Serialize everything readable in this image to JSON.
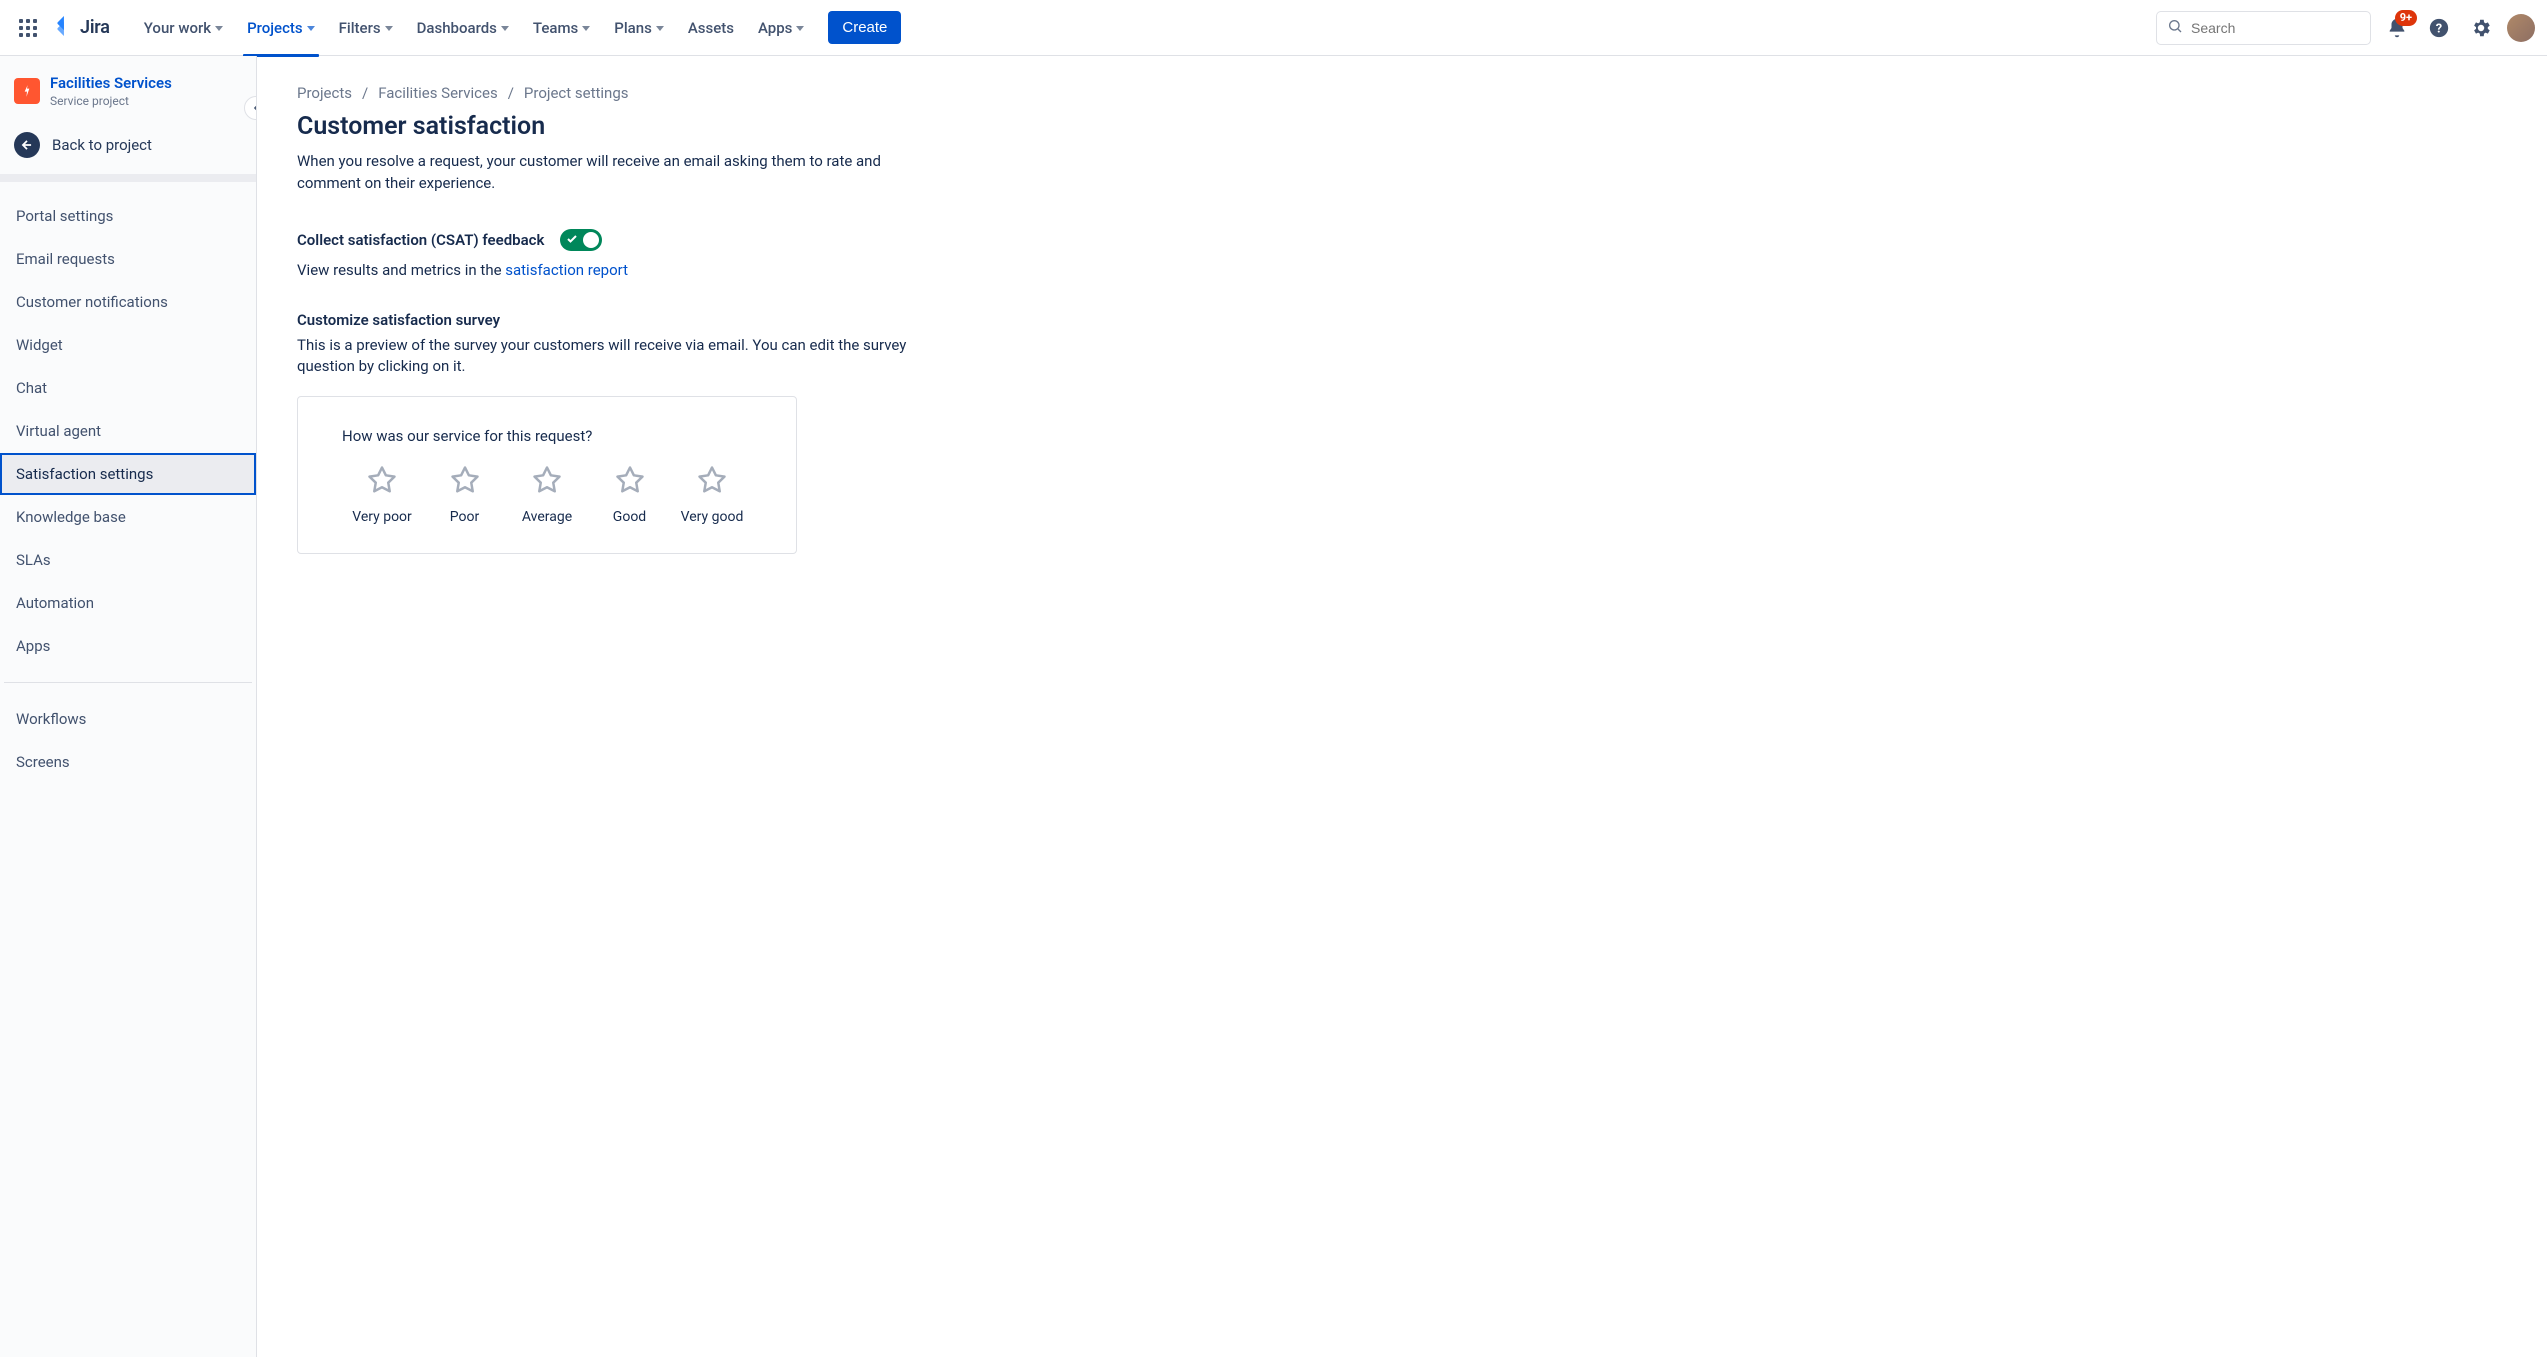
{
  "topnav": {
    "logo_text": "Jira",
    "items": [
      {
        "label": "Your work",
        "dropdown": true,
        "active": false
      },
      {
        "label": "Projects",
        "dropdown": true,
        "active": true
      },
      {
        "label": "Filters",
        "dropdown": true,
        "active": false
      },
      {
        "label": "Dashboards",
        "dropdown": true,
        "active": false
      },
      {
        "label": "Teams",
        "dropdown": true,
        "active": false
      },
      {
        "label": "Plans",
        "dropdown": true,
        "active": false
      },
      {
        "label": "Assets",
        "dropdown": false,
        "active": false
      },
      {
        "label": "Apps",
        "dropdown": true,
        "active": false
      }
    ],
    "create_label": "Create",
    "search_placeholder": "Search",
    "notification_badge": "9+"
  },
  "sidebar": {
    "project_name": "Facilities Services",
    "project_type": "Service project",
    "back_label": "Back to project",
    "group1": [
      "Portal settings",
      "Email requests",
      "Customer notifications",
      "Widget",
      "Chat",
      "Virtual agent",
      "Satisfaction settings",
      "Knowledge base",
      "SLAs",
      "Automation",
      "Apps"
    ],
    "selected_index": 6,
    "group2": [
      "Workflows",
      "Screens"
    ]
  },
  "breadcrumbs": [
    "Projects",
    "Facilities Services",
    "Project settings"
  ],
  "page": {
    "title": "Customer satisfaction",
    "description": "When you resolve a request, your customer will receive an email asking them to rate and comment on their experience.",
    "csat_label": "Collect satisfaction (CSAT) feedback",
    "csat_enabled": true,
    "results_prefix": "View results and metrics in the ",
    "results_link": "satisfaction report",
    "customize_label": "Customize satisfaction survey",
    "customize_desc": "This is a preview of the survey your customers will receive via email. You can edit the survey question by clicking on it.",
    "survey_question": "How was our service for this request?",
    "ratings": [
      "Very poor",
      "Poor",
      "Average",
      "Good",
      "Very good"
    ]
  }
}
